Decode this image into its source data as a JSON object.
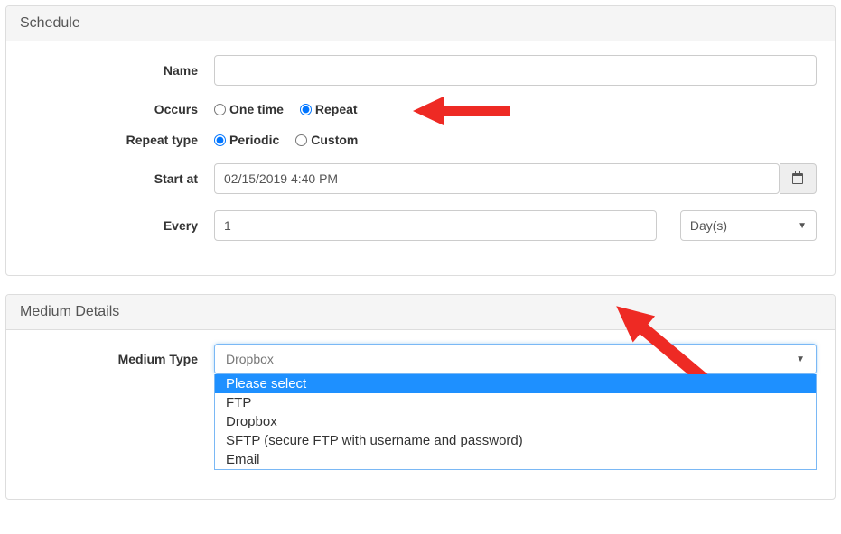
{
  "schedule": {
    "heading": "Schedule",
    "name_label": "Name",
    "name_value": "",
    "occurs_label": "Occurs",
    "occurs_options": {
      "one_time": "One time",
      "repeat": "Repeat"
    },
    "occurs_selected": "repeat",
    "repeat_type_label": "Repeat type",
    "repeat_type_options": {
      "periodic": "Periodic",
      "custom": "Custom"
    },
    "repeat_type_selected": "periodic",
    "start_at_label": "Start at",
    "start_at_value": "02/15/2019 4:40 PM",
    "every_label": "Every",
    "every_value": "1",
    "every_unit": "Day(s)"
  },
  "medium": {
    "heading": "Medium Details",
    "type_label": "Medium Type",
    "type_selected": "Dropbox",
    "type_options": [
      "Please select",
      "FTP",
      "Dropbox",
      "SFTP (secure FTP with username and password)",
      "Email"
    ],
    "type_highlight": "Please select"
  }
}
